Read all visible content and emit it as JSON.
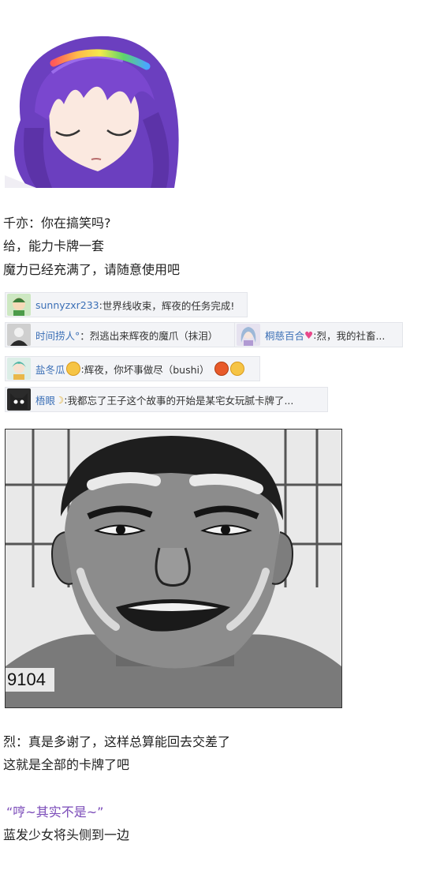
{
  "dialogue1": [
    "千亦：你在搞笑吗?",
    "给，能力卡牌一套",
    "魔力已经充满了，请随意使用吧"
  ],
  "comments": [
    {
      "user": "sunnyzxr233",
      "sep": ": ",
      "text": "世界线收束，辉夜的任务完成!"
    },
    {
      "user": "时间捞人°",
      "sep": "：",
      "text": "烈逃出来辉夜的魔爪（抹泪）"
    },
    {
      "user": "桐慈百合",
      "sep": ": ",
      "text": "烈，我的社畜..."
    },
    {
      "user": "盐冬瓜",
      "sep": ": ",
      "text": "辉夜，你坏事做尽（bushi）"
    },
    {
      "user": "梧眼",
      "sep": ": ",
      "text": "我都忘了王子这个故事的开始是某宅女玩腻卡牌了..."
    }
  ],
  "manga_number": "9104",
  "dialogue2": [
    "烈：真是多谢了，这样总算能回去交差了",
    "这就是全部的卡牌了吧"
  ],
  "quote": "“哼~其实不是~”",
  "narration": "蓝发少女将头侧到一边",
  "colors": {
    "quote": "#7a4ab8",
    "username": "#3b6fb6",
    "comment_bg": "#f3f4f7"
  }
}
